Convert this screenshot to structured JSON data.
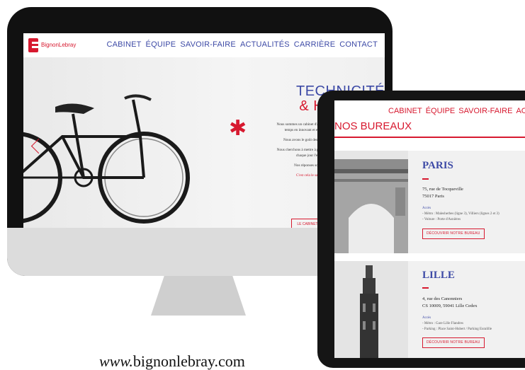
{
  "desktop": {
    "brand": "BignonLebray",
    "nav": [
      "CABINET",
      "ÉQUIPE",
      "SAVOIR-FAIRE",
      "ACTUALITÉS",
      "CARRIÈRE",
      "CONTACT"
    ],
    "hero_title_1": "TECHNICITÉ",
    "hero_title_2": "& HABILETÉ",
    "hero_lines": [
      "Nous sommes un cabinet d'avocats d'affaires, nous",
      "temps en innovant et en s'accommodant",
      "Nous avons le goût des choses bien faites",
      "Nous cherchons à mettre à profit nos compétences",
      "chaque jour l'expérience",
      "Nos réponses sont précises"
    ],
    "hero_tagline": "C'est cela le savoir-faire",
    "cta": "LE CABINET"
  },
  "tablet": {
    "nav": [
      "CABINET",
      "ÉQUIPE",
      "SAVOIR-FAIRE",
      "ACTU"
    ],
    "page_title": "NOS BUREAUX",
    "offices": [
      {
        "city": "PARIS",
        "address_1": "75, rue de Tocqueville",
        "address_2": "75017 Paris",
        "access_label": "Accès",
        "access_1": "- Métro : Malesherbes (ligne 3), Villiers (lignes 2 et 3)",
        "access_2": "- Voiture : Porte d'Asnières",
        "button": "DÉCOUVRIR NOTRE BUREAU"
      },
      {
        "city": "LILLE",
        "address_1": "4, rue des Canonniers",
        "address_2": "CS 10009, 59041 Lille Cedex",
        "access_label": "Accès",
        "access_1": "- Métro : Gare Lille Flandres",
        "access_2": "- Parking : Place Saint-Hubert / Parking Euralille",
        "button": "DÉCOUVRIR NOTRE BUREAU"
      }
    ]
  },
  "footer_url": {
    "prefix": "www.",
    "domain": "bignonlebray.com"
  },
  "colors": {
    "accent_red": "#d7192f",
    "nav_blue": "#3d4aa6"
  }
}
